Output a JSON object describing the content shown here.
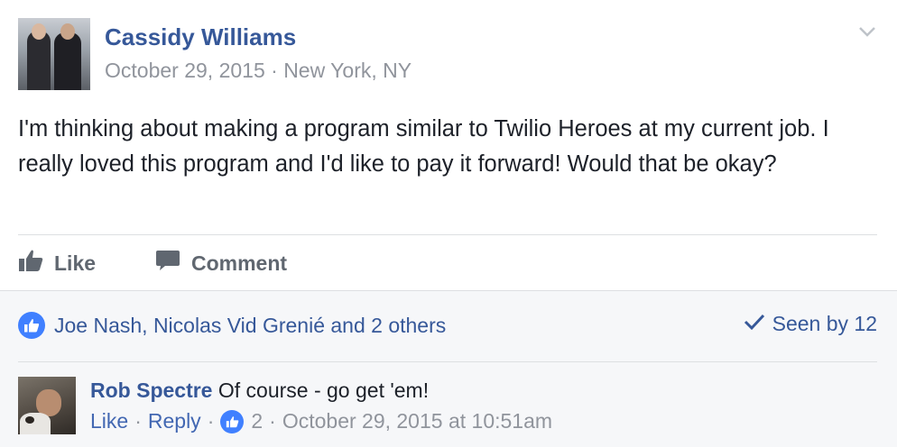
{
  "post": {
    "author": "Cassidy Williams",
    "date": "October 29, 2015",
    "meta_separator": "·",
    "location": "New York, NY",
    "text": "I'm thinking about making a program similar to Twilio Heroes at my current job. I really loved this program and I'd like to pay it forward! Would that be okay?"
  },
  "actions": {
    "like_label": "Like",
    "comment_label": "Comment"
  },
  "reactions": {
    "summary": "Joe Nash, Nicolas Vid Grenié and 2 others",
    "seen_label": "Seen by 12"
  },
  "comment": {
    "author": "Rob Spectre",
    "text": "Of course - go get 'em!",
    "like_label": "Like",
    "reply_label": "Reply",
    "separator": "·",
    "like_count": "2",
    "timestamp": "October 29, 2015 at 10:51am"
  },
  "colors": {
    "link_blue": "#365899",
    "like_badge": "#4080ff",
    "meta_gray": "#90949c",
    "action_gray": "#606770",
    "footer_bg": "#f6f7f9"
  },
  "icons": {
    "post_options": "chevron-down-icon",
    "like": "thumbs-up-icon",
    "comment": "speech-bubble-icon",
    "seen": "checkmark-icon"
  }
}
